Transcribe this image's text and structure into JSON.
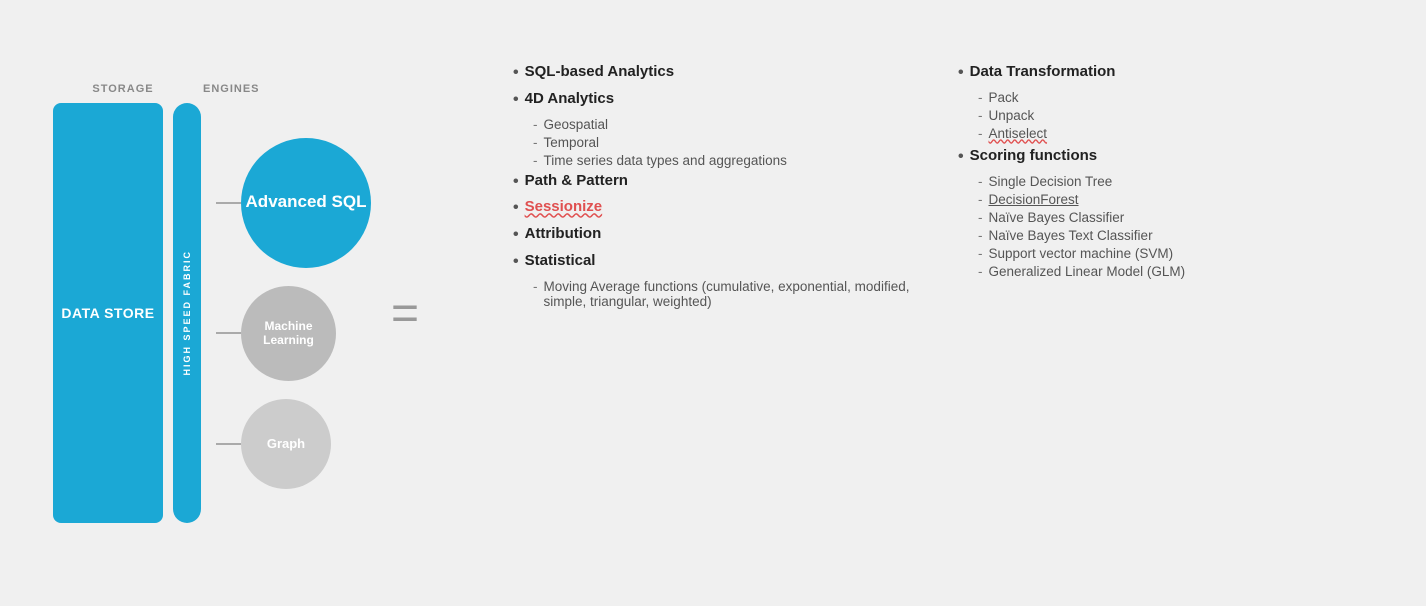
{
  "diagram": {
    "storage_label": "STORAGE",
    "engines_label": "ENGINES",
    "data_store_text": "DATA STORE",
    "fabric_text": "HIGH SPEED FABRIC",
    "advanced_sql_text": "Advanced SQL",
    "machine_learning_text": "Machine Learning",
    "graph_text": "Graph",
    "equals": "="
  },
  "col_left": {
    "items": [
      {
        "type": "bold",
        "text": "SQL-based Analytics"
      },
      {
        "type": "bold",
        "text": "4D Analytics"
      },
      {
        "type": "sub",
        "items": [
          "Geospatial",
          "Temporal",
          "Time series data types and aggregations"
        ]
      },
      {
        "type": "bold",
        "text": "Path & Pattern"
      },
      {
        "type": "bold",
        "text": "Sessionize",
        "underline": true
      },
      {
        "type": "bold",
        "text": "Attribution"
      },
      {
        "type": "bold",
        "text": "Statistical"
      },
      {
        "type": "sub",
        "items": [
          "Moving Average functions (cumulative, exponential, modified, simple, triangular, weighted)"
        ]
      }
    ]
  },
  "col_right": {
    "items": [
      {
        "type": "bold",
        "text": "Data Transformation"
      },
      {
        "type": "sub",
        "items": [
          {
            "text": "Pack",
            "underline": false
          },
          {
            "text": "Unpack",
            "underline": false
          },
          {
            "text": "Antiselect",
            "underline": "wavy-red"
          }
        ]
      },
      {
        "type": "bold",
        "text": "Scoring functions"
      },
      {
        "type": "sub",
        "items": [
          {
            "text": "Single Decision Tree",
            "underline": false
          },
          {
            "text": "DecisionForest",
            "underline": "solid"
          },
          {
            "text": "Naïve Bayes Classifier",
            "underline": false
          },
          {
            "text": "Naïve Bayes Text Classifier",
            "underline": false
          },
          {
            "text": "Support vector machine (SVM)",
            "underline": false
          },
          {
            "text": "Generalized Linear Model (GLM)",
            "underline": false
          }
        ]
      }
    ]
  }
}
